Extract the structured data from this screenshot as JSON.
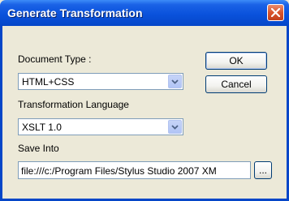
{
  "window": {
    "title": "Generate Transformation"
  },
  "doc_type": {
    "label": "Document Type :",
    "value": "HTML+CSS"
  },
  "lang": {
    "label": "Transformation Language",
    "value": "XSLT 1.0"
  },
  "save": {
    "label": "Save Into",
    "value": "file:///c:/Program Files/Stylus Studio 2007 XM",
    "browse_label": "..."
  },
  "buttons": {
    "ok": "OK",
    "cancel": "Cancel"
  },
  "colors": {
    "titlebar": "#0a52dc",
    "dialog_bg": "#ece9d8",
    "close": "#d9542c"
  }
}
